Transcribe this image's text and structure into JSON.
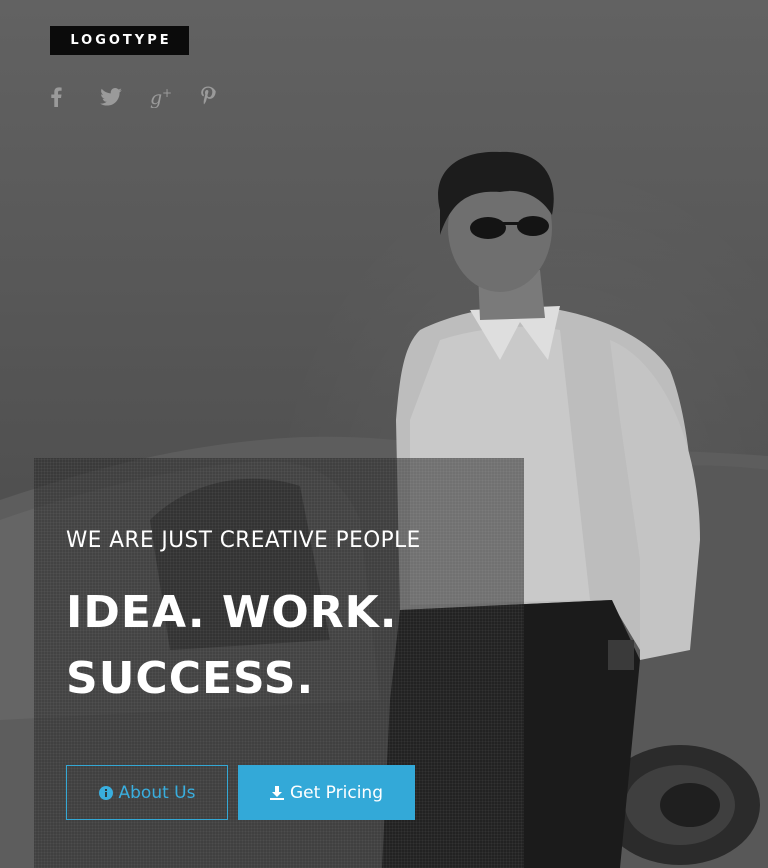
{
  "header": {
    "logo": "LOGOTYPE",
    "social": [
      {
        "name": "facebook-icon",
        "glyph": "f"
      },
      {
        "name": "twitter-icon",
        "glyph": "twitter"
      },
      {
        "name": "google-plus-icon",
        "glyph": "g+"
      },
      {
        "name": "pinterest-icon",
        "glyph": "p"
      }
    ]
  },
  "hero": {
    "tagline": "WE ARE JUST CREATIVE PEOPLE",
    "headline_line1": "IDEA. WORK.",
    "headline_line2": "SUCCESS.",
    "buttons": {
      "about": {
        "label": "About Us",
        "icon": "info-icon"
      },
      "pricing": {
        "label": "Get Pricing",
        "icon": "download-icon"
      }
    }
  },
  "colors": {
    "accent": "#33a9d8",
    "logo_bg": "#0b0b0b",
    "text": "#ffffff"
  }
}
